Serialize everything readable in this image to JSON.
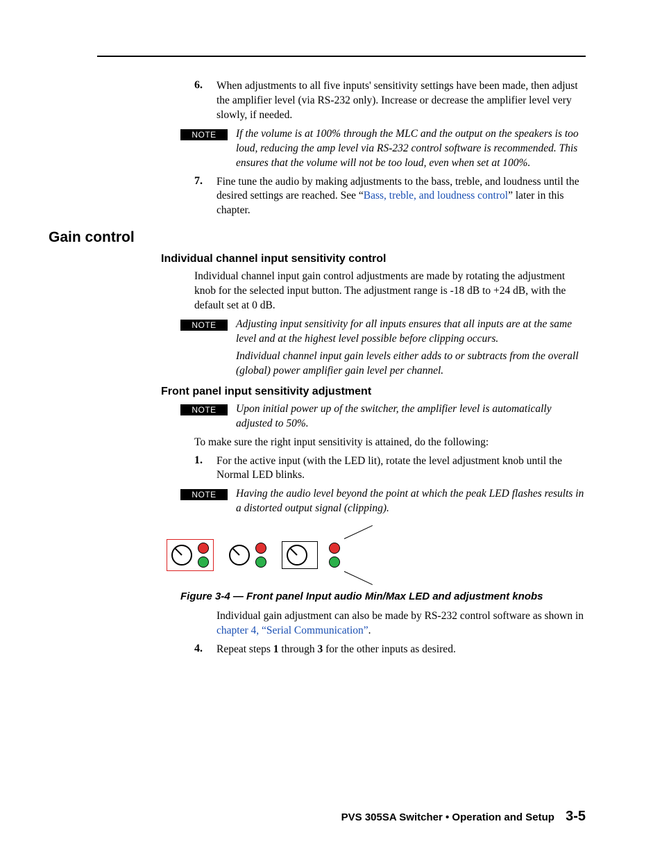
{
  "note_label": "NOTE",
  "step6_num": "6.",
  "step6_text": "When adjustments to all five inputs' sensitivity settings have been made, then adjust the amplifier level (via RS-232 only).  Increase or decrease the amplifier level very slowly, if needed.",
  "step6_note": "If the volume is at 100% through the MLC and the output on the speakers is too loud, reducing the amp level via RS-232 control software is recommended.  This ensures that the volume will not be too loud, even when set at 100%.",
  "step7_num": "7.",
  "step7_text_a": "Fine tune the audio by making adjustments to the bass, treble, and loudness until the desired settings are reached.  See “",
  "step7_link": "Bass, treble, and loudness control",
  "step7_text_b": "” later in this chapter.",
  "h2_gain": "Gain control",
  "h3_individual": "Individual channel input sensitivity control",
  "individual_body": "Individual channel input gain control adjustments are made by rotating the adjustment knob for the selected input button.  The adjustment range is -18 dB to +24 dB, with the default set at 0 dB.",
  "individual_note_a": "Adjusting input sensitivity for all inputs ensures that all inputs are at the same level and at the highest level possible before clipping occurs.",
  "individual_note_b": "Individual channel input gain levels either adds to or subtracts from the overall (global) power amplifier gain level per channel.",
  "h3_front": "Front panel input sensitivity adjustment",
  "front_note1": "Upon initial power up of the switcher, the amplifier level is automatically adjusted to 50%.",
  "front_body": "To make sure the right input sensitivity is attained, do the following:",
  "front_step1_num": "1.",
  "front_step1_text": "For the active input (with the LED lit), rotate the level adjustment knob until the Normal LED blinks.",
  "front_note2": "Having the audio level beyond the point at which the peak LED flashes results in a distorted output signal (clipping).",
  "fig_caption": "Figure 3-4 — Front panel Input audio Min/Max LED and adjustment knobs",
  "after_fig_a": "Individual gain adjustment can also be made by RS-232 control software as shown in ",
  "after_fig_link": "chapter 4, “Serial Communication”",
  "after_fig_b": ".",
  "front_step4_num": "4.",
  "front_step4_a": "Repeat steps ",
  "front_step4_b": "1",
  "front_step4_c": " through ",
  "front_step4_d": "3",
  "front_step4_e": " for the other inputs as desired.",
  "footer_title": "PVS 305SA Switcher • Operation and Setup",
  "footer_page": "3-5"
}
